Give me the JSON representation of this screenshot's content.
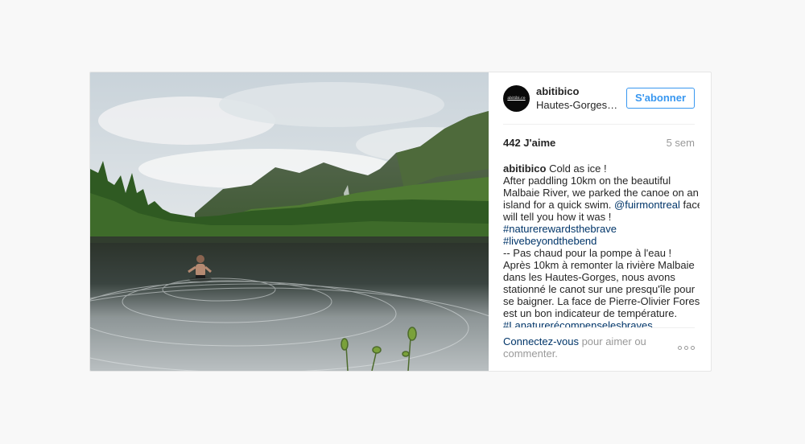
{
  "post": {
    "account": {
      "avatar_text": "abitibi.co",
      "username": "abitibico",
      "location": "Hautes-Gorges-de-la-Rivière-Malbaie"
    },
    "follow_label": "S'abonner",
    "likes": "442 J'aime",
    "age": "5 sem",
    "caption": {
      "author": "abitibico",
      "line1_text": " Cold as ice !",
      "line2": "After paddling 10km on the beautiful",
      "line3": "Malbaie River, we parked the canoe on an",
      "line4": "island for a quick swim.",
      "mention": "@fuirmontreal",
      "line5_after": " face",
      "line6": "will tell you how it was !",
      "hashtag1": "#naturerewardsthebrave",
      "hashtag2": "#livebeyondthebend",
      "line9": "-- Pas chaud pour la pompe à l'eau !",
      "line10": "Après 10km à remonter la rivière Malbaie",
      "line11": "dans les Hautes-Gorges, nous avons",
      "line12": "stationné le canot sur une presqu'île pour",
      "line13": "se baigner. La face de Pierre-Olivier Forest",
      "line14": "est un bon indicateur de température.",
      "hashtag3": "#Lanaturerécompenselesbraves"
    },
    "footer": {
      "connect_link": "Connectez-vous",
      "connect_rest_1": " pour aimer ou",
      "connect_rest_2": "commenter."
    },
    "more_icon": "ellipsis-icon"
  },
  "colors": {
    "accent": "#3897f0",
    "link": "#003569",
    "muted": "#999999",
    "text": "#262626",
    "page_bg": "#f8f8f8"
  }
}
